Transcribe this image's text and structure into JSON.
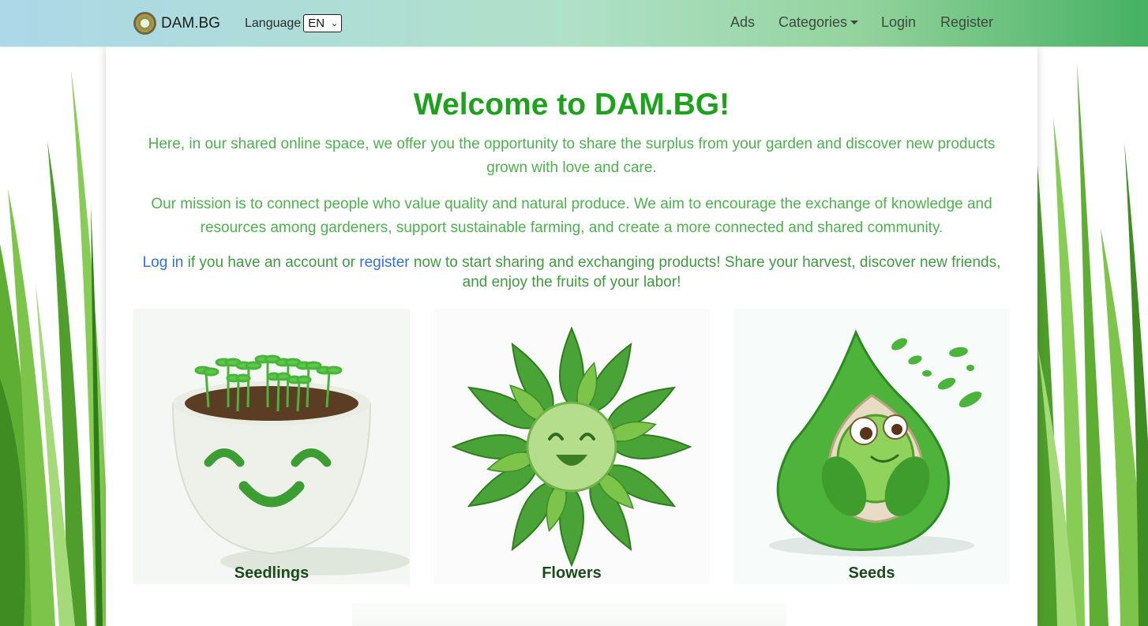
{
  "navbar": {
    "brand": "DAM.BG",
    "language_label": "Language",
    "language_value": "EN",
    "links": [
      "Ads",
      "Categories",
      "Login",
      "Register"
    ]
  },
  "hero": {
    "title": "Welcome to DAM.BG!",
    "paragraph1": "Here, in our shared online space, we offer you the opportunity to share the surplus from your garden and discover new products grown with love and care.",
    "paragraph2": "Our mission is to connect people who value quality and natural produce. We aim to encourage the exchange of knowledge and resources among gardeners, support sustainable farming, and create a more connected and shared community.",
    "cta": {
      "login_link": "Log in",
      "text_middle": " if you have an account or ",
      "register_link": "register",
      "text_end": " now to start sharing and exchanging products! Share your harvest, discover new friends, and enjoy the fruits of your labor!"
    }
  },
  "categories": [
    {
      "label": "Seedlings",
      "image": "smiling-pot-with-sprouts"
    },
    {
      "label": "Flowers",
      "image": "smiling-green-flower"
    },
    {
      "label": "Seeds",
      "image": "smiling-seed-pod"
    }
  ],
  "colors": {
    "title_green": "#1ea21e",
    "paragraph_green": "#4cb24c",
    "link_blue": "#2f74d4",
    "label_dark_green": "#1b4a1b",
    "nav_gradient": [
      "#acd8e8",
      "#b0e1c8",
      "#93d39d",
      "#45b162"
    ]
  }
}
